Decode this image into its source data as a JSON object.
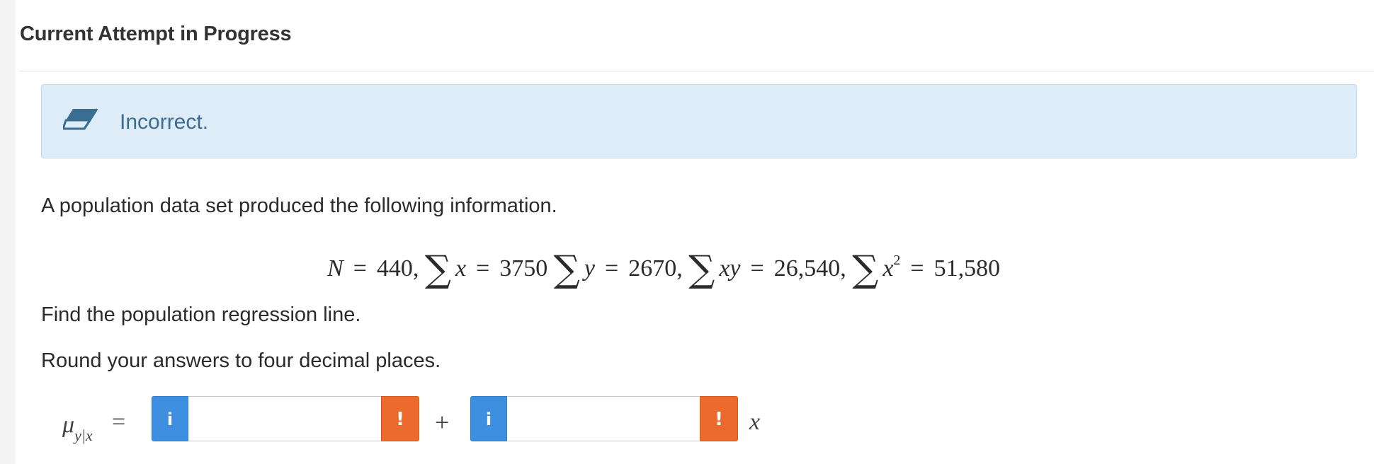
{
  "header": {
    "title": "Current Attempt in Progress"
  },
  "feedback": {
    "status_text": "Incorrect.",
    "icon": "eraser-icon"
  },
  "question": {
    "intro": "A population data set produced the following information.",
    "formula": {
      "N_label": "N",
      "N_value": "440,",
      "sum_x_var": "x",
      "sum_x_value": "3750",
      "sum_y_var": "y",
      "sum_y_value": "2670,",
      "sum_xy_var": "xy",
      "sum_xy_value": "26,540,",
      "sum_x2_var": "x",
      "sum_x2_exp": "2",
      "sum_x2_value": "51,580",
      "sigma": "∑",
      "equals": "="
    },
    "task": "Find the population regression line.",
    "instruction": "Round your answers to four decimal places."
  },
  "answer": {
    "mu_symbol": "μ",
    "mu_subscript": "y|x",
    "equals": "=",
    "plus": "+",
    "variable": "x",
    "info_glyph": "i",
    "warn_glyph": "!",
    "intercept_value": "",
    "slope_value": "",
    "colors": {
      "info": "#3f8fe0",
      "warning": "#ec6a2c"
    }
  }
}
